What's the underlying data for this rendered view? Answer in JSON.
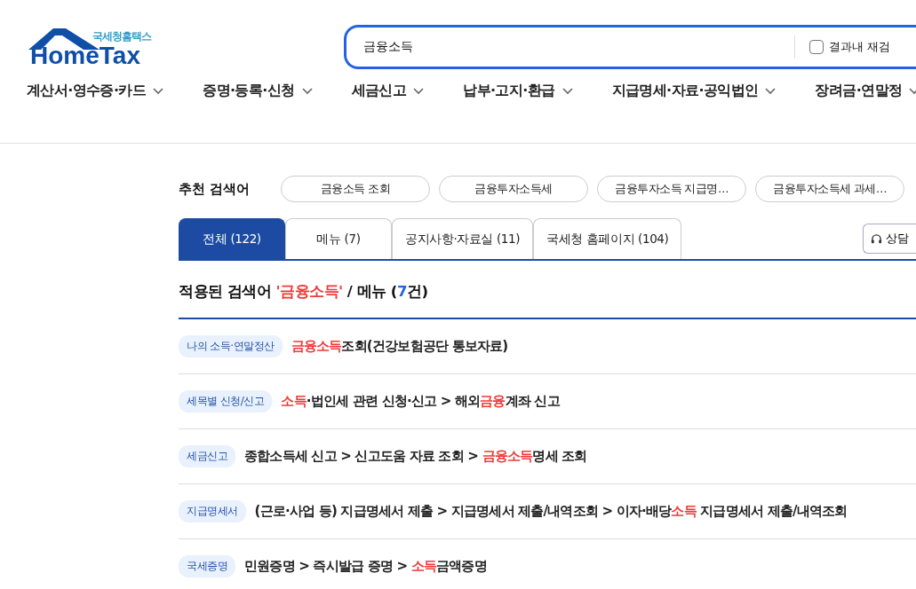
{
  "logo": {
    "subtitle": "국세청홈택스",
    "title": "HomeTax"
  },
  "search": {
    "value": "금융소득",
    "refine": {
      "label": "결과내 재검",
      "checked": false
    }
  },
  "nav": [
    {
      "label": "계산서·영수증·카드"
    },
    {
      "label": "증명·등록·신청"
    },
    {
      "label": "세금신고"
    },
    {
      "label": "납부·고지·환급"
    },
    {
      "label": "지급명세·자료·공익법인"
    },
    {
      "label": "장려금·연말정"
    }
  ],
  "recommended": {
    "label": "추천 검색어",
    "keywords": [
      "금융소득 조회",
      "금융투자소득세",
      "금융투자소득 지급명…",
      "금융투자소득세 과세…"
    ]
  },
  "tabs": [
    {
      "label": "전체 (122)",
      "selected": true
    },
    {
      "label": "메뉴 (7)",
      "selected": false
    },
    {
      "label": "공지사항·자료실 (11)",
      "selected": false
    },
    {
      "label": "국세청 홈페이지 (104)",
      "selected": false
    }
  ],
  "consult_button": "상담",
  "heading": {
    "prefix": "적용된 검색어",
    "term": "'금융소득'",
    "middle": "/ 메뉴 (",
    "count": "7",
    "suffix": "건)"
  },
  "results": [
    {
      "category": "나의 소득·연말정산",
      "parts": [
        {
          "text": "금융소득",
          "highlight": true
        },
        {
          "text": "조회(건강보험공단 통보자료)",
          "highlight": false
        }
      ]
    },
    {
      "category": "세목별 신청/신고",
      "parts": [
        {
          "text": "소득",
          "highlight": true
        },
        {
          "text": "·법인세 관련 신청·신고 > 해외",
          "highlight": false
        },
        {
          "text": "금융",
          "highlight": true
        },
        {
          "text": "계좌 신고",
          "highlight": false
        }
      ]
    },
    {
      "category": "세금신고",
      "parts": [
        {
          "text": "종합소득세 신고 > 신고도움 자료 조회 > ",
          "highlight": false
        },
        {
          "text": "금융소득",
          "highlight": true
        },
        {
          "text": "명세 조회",
          "highlight": false
        }
      ]
    },
    {
      "category": "지급명세서",
      "parts": [
        {
          "text": "(근로·사업 등) 지급명세서 제출 > 지급명세서 제출/내역조회 > 이자·배당",
          "highlight": false
        },
        {
          "text": "소득",
          "highlight": true
        },
        {
          "text": " 지급명세서 제출/내역조회",
          "highlight": false
        }
      ]
    },
    {
      "category": "국세증명",
      "parts": [
        {
          "text": "민원증명 > 즉시발급 증명 > ",
          "highlight": false
        },
        {
          "text": "소득",
          "highlight": true
        },
        {
          "text": "금액증명",
          "highlight": false
        }
      ]
    }
  ]
}
